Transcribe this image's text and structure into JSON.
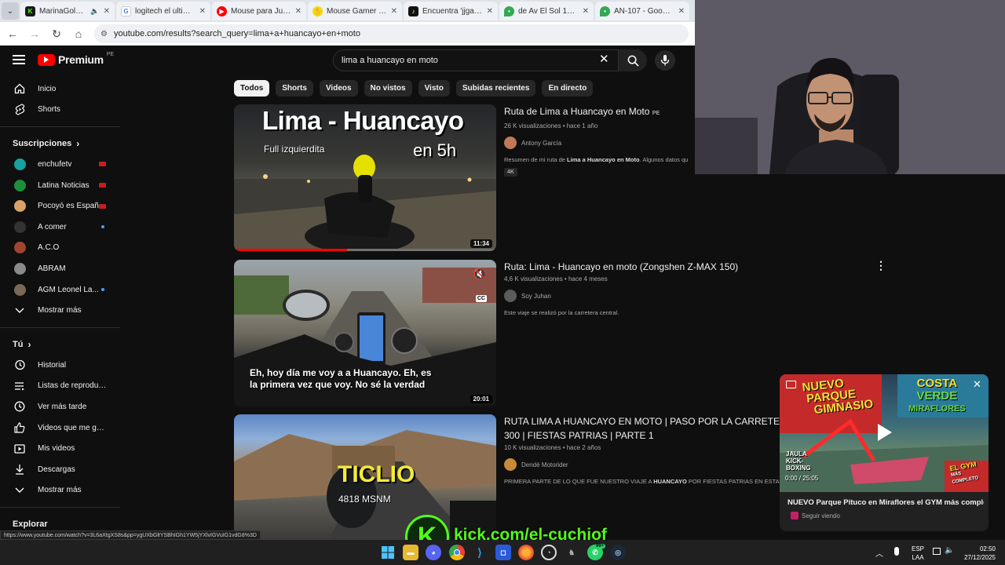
{
  "browser": {
    "tabs": [
      {
        "label": "MarinaGold Strea",
        "favicon": "kick-icon",
        "color": "#53fc18"
      },
      {
        "label": "logitech el ultimo qu",
        "favicon": "google-icon",
        "color": "#4285f4"
      },
      {
        "label": "Mouse para Juegos R",
        "favicon": "youtube-icon",
        "color": "#ff0000"
      },
      {
        "label": "Mouse Gamer Logitec",
        "favicon": "mercadolibre-icon",
        "color": "#f5d90a"
      },
      {
        "label": "Encuentra 'jjgamer' ei",
        "favicon": "tiktok-icon",
        "color": "#111111"
      },
      {
        "label": "de Av El Sol 1411, Ch",
        "favicon": "maps-icon",
        "color": "#34a853"
      },
      {
        "label": "AN-107 - Google Ma",
        "favicon": "maps-icon",
        "color": "#34a853"
      }
    ],
    "url": "youtube.com/results?search_query=lima+a+huancayo+en+moto",
    "status_url": "https://www.youtube.com/watch?v=3L6aXtgXS8s&pp=ygUXbGltYSBhIGh1YW5jYXlvIGVuIG1vdG8%3D"
  },
  "youtube": {
    "logo_text": "Premium",
    "logo_region": "PE",
    "search_query": "lima a huancayo en moto",
    "chips": [
      "Todos",
      "Shorts",
      "Videos",
      "No vistos",
      "Visto",
      "Subidas recientes",
      "En directo"
    ],
    "sidebar": {
      "top": [
        {
          "label": "Inicio",
          "icon": "home-icon"
        },
        {
          "label": "Shorts",
          "icon": "shorts-icon"
        }
      ],
      "subs_header": "Suscripciones",
      "subs": [
        {
          "label": "enchufetv",
          "color": "#19a0a0",
          "mark": "live"
        },
        {
          "label": "Latina Noticias",
          "color": "#1e8f3a",
          "mark": "live"
        },
        {
          "label": "Pocoyó es Españ...",
          "color": "#d9a266",
          "mark": "live"
        },
        {
          "label": "A comer",
          "color": "#333333",
          "mark": "dot"
        },
        {
          "label": "A.C.O",
          "color": "#a0442f",
          "mark": "none"
        },
        {
          "label": "ABRAM",
          "color": "#8a8a8a",
          "mark": "none"
        },
        {
          "label": "AGM Leonel La...",
          "color": "#7a6a55",
          "mark": "dot"
        }
      ],
      "subs_more": "Mostrar más",
      "you_header": "Tú",
      "you": [
        {
          "label": "Historial",
          "icon": "history-icon"
        },
        {
          "label": "Listas de reproducc...",
          "icon": "playlists-icon"
        },
        {
          "label": "Ver más tarde",
          "icon": "watch-later-icon"
        },
        {
          "label": "Videos que me gus...",
          "icon": "like-icon"
        },
        {
          "label": "Mis videos",
          "icon": "my-videos-icon"
        },
        {
          "label": "Descargas",
          "icon": "download-icon"
        }
      ],
      "you_more": "Mostrar más",
      "explore_header": "Explorar"
    },
    "results": [
      {
        "title": "Ruta de Lima a Huancayo en Moto",
        "title_suffix": "PE",
        "meta": "26 K visualizaciones • hace 1 año",
        "channel": "Antony García",
        "desc_pre": "Resumen de mi ruta de ",
        "desc_bold": "Lima a Huancayo en Moto",
        "desc_post": ". Algunos datos qu",
        "badge": "4K",
        "duration": "11:34",
        "thumb_title": "Lima - Huancayo",
        "thumb_sub": "Full izquierdita",
        "thumb_time": "en 5h",
        "watched_fraction": 0.43
      },
      {
        "title": "Ruta: Lima - Huancayo en moto (Zongshen Z-MAX 150)",
        "meta": "4,6 K visualizaciones • hace 4 meses",
        "channel": "Soy Juhan",
        "desc": "Este viaje se realizó por la carretera central.",
        "duration": "20:01",
        "caption_line1": "Eh, hoy día me voy a a Huancayo. Eh, es",
        "caption_line2": "la primera vez que voy. No sé la verdad",
        "cc_label": "CC"
      },
      {
        "title_line1": "RUTA LIMA A HUANCAYO EN MOTO | PASO POR LA CARRETERA C",
        "title_line2": "300 | FIESTAS PATRIAS | PARTE 1",
        "meta": "10 K visualizaciones • hace 2 años",
        "channel": "Dendé Motorider",
        "desc_pre": "PRIMERA PARTE DE LO QUE FUE NUESTRO VIAJE A ",
        "desc_bold": "HUANCAYO",
        "desc_post": " POR FIESTAS PATRIAS EN ESTA C",
        "thumb_title": "TICLIO",
        "thumb_sub": "4818 MSNM"
      }
    ],
    "miniplayer": {
      "title": "NUEVO Parque Pituco en Miraflores el GYM más complet...",
      "status": "Seguir viendo",
      "time": "0:00 / 25:05",
      "overlay_left1": "NUEVO",
      "overlay_left2": "PARQUE",
      "overlay_left3": "GIMNASIO",
      "overlay_right1": "COSTA",
      "overlay_right2": "VERDE",
      "overlay_right3": "MIRAFLORES",
      "overlay_bottom_left": "JAULA KICK-BOXING",
      "overlay_bottom_right1": "EL GYM",
      "overlay_bottom_right2": "MÁS COMPLETO"
    }
  },
  "stream_overlay": {
    "kick_text": "kick.com/el-cuchiof",
    "kick_logo": "K"
  },
  "taskbar": {
    "lang1": "ESP",
    "lang2": "LAA",
    "time": "02:50",
    "date": "27/12/2025",
    "whatsapp_badge": "99+"
  }
}
